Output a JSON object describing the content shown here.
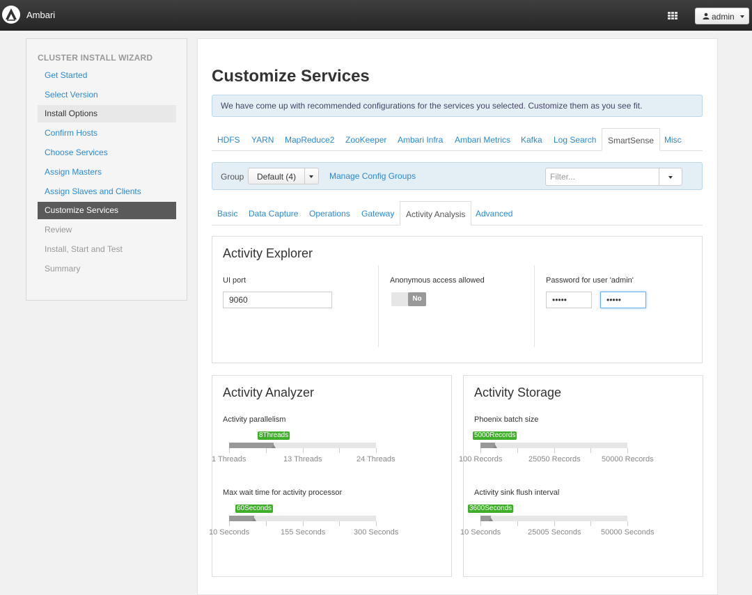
{
  "app": {
    "title": "Ambari",
    "user": "admin"
  },
  "sidebar": {
    "title": "CLUSTER INSTALL WIZARD",
    "items": [
      {
        "label": "Get Started",
        "state": "done"
      },
      {
        "label": "Select Version",
        "state": "done"
      },
      {
        "label": "Install Options",
        "state": "highlight"
      },
      {
        "label": "Confirm Hosts",
        "state": "done"
      },
      {
        "label": "Choose Services",
        "state": "done"
      },
      {
        "label": "Assign Masters",
        "state": "done"
      },
      {
        "label": "Assign Slaves and Clients",
        "state": "done"
      },
      {
        "label": "Customize Services",
        "state": "active"
      },
      {
        "label": "Review",
        "state": "todo"
      },
      {
        "label": "Install, Start and Test",
        "state": "todo"
      },
      {
        "label": "Summary",
        "state": "todo"
      }
    ]
  },
  "main": {
    "title": "Customize Services",
    "alert": "We have come up with recommended configurations for the services you selected. Customize them as you see fit.",
    "service_tabs": [
      "HDFS",
      "YARN",
      "MapReduce2",
      "ZooKeeper",
      "Ambari Infra",
      "Ambari Metrics",
      "Kafka",
      "Log Search",
      "SmartSense",
      "Misc"
    ],
    "active_service_tab": "SmartSense",
    "group": {
      "label": "Group",
      "value": "Default (4)",
      "manage_link": "Manage Config Groups",
      "filter_placeholder": "Filter..."
    },
    "sub_tabs": [
      "Basic",
      "Data Capture",
      "Operations",
      "Gateway",
      "Activity Analysis",
      "Advanced"
    ],
    "active_sub_tab": "Activity Analysis"
  },
  "explorer": {
    "title": "Activity Explorer",
    "ui_port_label": "UI port",
    "ui_port_value": "9060",
    "anon_label": "Anonymous access allowed",
    "anon_toggle": "No",
    "password_label": "Password for user 'admin'",
    "password_value": "•••••",
    "password_confirm_value": "•••••"
  },
  "analyzer": {
    "title": "Activity Analyzer",
    "parallelism": {
      "label": "Activity parallelism",
      "badge": "8Threads",
      "min": 1,
      "max": 24,
      "value": 8,
      "ticks": [
        "1 Threads",
        "13 Threads",
        "24 Threads"
      ]
    },
    "wait_time": {
      "label": "Max wait time for activity processor",
      "badge": "60Seconds",
      "min": 10,
      "max": 300,
      "value": 60,
      "ticks": [
        "10 Seconds",
        "155 Seconds",
        "300 Seconds"
      ]
    }
  },
  "storage": {
    "title": "Activity Storage",
    "batch_size": {
      "label": "Phoenix batch size",
      "badge": "5000Records",
      "min": 100,
      "max": 50000,
      "value": 5000,
      "ticks": [
        "100 Records",
        "25050 Records",
        "50000 Records"
      ]
    },
    "flush_interval": {
      "label": "Activity sink flush interval",
      "badge": "3600Seconds",
      "min": 10,
      "max": 50000,
      "value": 3600,
      "ticks": [
        "10 Seconds",
        "25005 Seconds",
        "50000 Seconds"
      ]
    }
  }
}
